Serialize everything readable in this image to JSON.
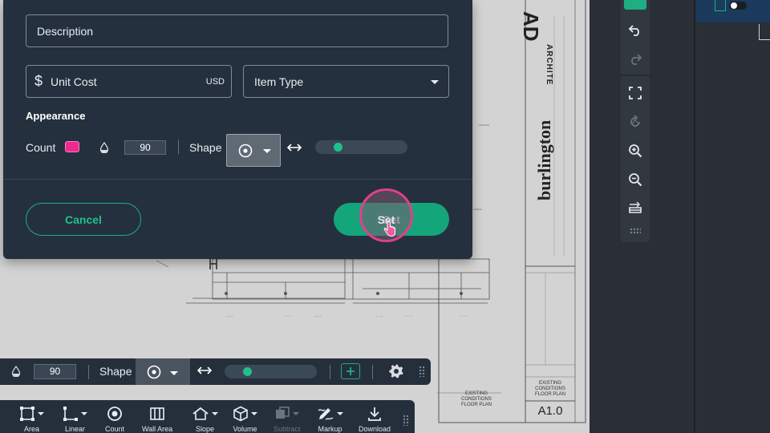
{
  "modal": {
    "description_placeholder": "Description",
    "unit_cost_symbol": "$",
    "unit_cost_placeholder": "Unit Cost",
    "unit_cost_currency": "USD",
    "item_type_placeholder": "Item Type",
    "appearance_label": "Appearance",
    "count_label": "Count",
    "count_color": "#ee2a8f",
    "opacity_value": "90",
    "shape_label": "Shape",
    "shape_selected_icon": "target-circle-icon",
    "size_slider_fraction": 0.1,
    "cancel_label": "Cancel",
    "set_label": "Set"
  },
  "props_bar": {
    "opacity_value": "90",
    "shape_label": "Shape",
    "size_slider_fraction": 0.1
  },
  "tool_bar": {
    "tools": [
      {
        "label": "Area",
        "icon": "area-icon",
        "has_dropdown": true,
        "enabled": true
      },
      {
        "label": "Linear",
        "icon": "linear-icon",
        "has_dropdown": true,
        "enabled": true
      },
      {
        "label": "Count",
        "icon": "count-icon",
        "has_dropdown": false,
        "enabled": true
      },
      {
        "label": "Wall Area",
        "icon": "wall-area-icon",
        "has_dropdown": false,
        "enabled": true
      },
      {
        "label": "Slope",
        "icon": "slope-icon",
        "has_dropdown": true,
        "enabled": true
      },
      {
        "label": "Volume",
        "icon": "volume-icon",
        "has_dropdown": true,
        "enabled": true
      },
      {
        "label": "Subtract",
        "icon": "subtract-icon",
        "has_dropdown": true,
        "enabled": false
      },
      {
        "label": "Markup",
        "icon": "markup-icon",
        "has_dropdown": true,
        "enabled": true
      },
      {
        "label": "Download",
        "icon": "download-icon",
        "has_dropdown": false,
        "enabled": true
      }
    ]
  },
  "vertical_toolbar": {
    "items": [
      {
        "icon": "undo-icon",
        "enabled": true
      },
      {
        "icon": "redo-icon",
        "enabled": false
      },
      {
        "icon": "fit-screen-icon",
        "enabled": true
      },
      {
        "icon": "rotate-icon",
        "enabled": false
      },
      {
        "icon": "zoom-in-icon",
        "enabled": true
      },
      {
        "icon": "zoom-out-icon",
        "enabled": true
      },
      {
        "icon": "layers-icon",
        "enabled": true
      }
    ]
  },
  "drawing": {
    "firm_logo_letters": "AD",
    "firm_name_fragment": "ARCHITE",
    "project_name": "burlington",
    "sheet_title_left": "EXISTING CONDITIONS FLOOR PLAN",
    "sheet_title_block": "EXISTING CONDITIONS FLOOR PLAN",
    "sheet_number": "A1.0"
  },
  "colors": {
    "accent_green": "#1fae82",
    "modal_bg": "#24303d",
    "highlight_pink": "#e0408d",
    "count_pink": "#ee2a8f"
  }
}
